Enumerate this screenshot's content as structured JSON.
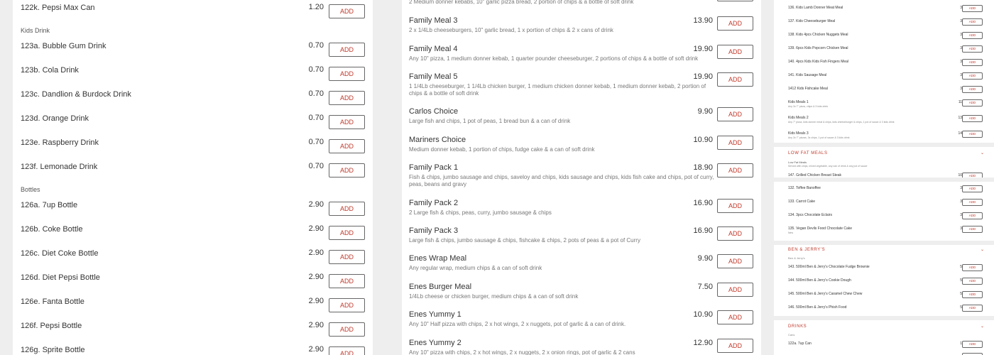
{
  "add_label": "ADD",
  "panel1": {
    "top_item": {
      "name": "122k. Pepsi Max Can",
      "price": "1.20"
    },
    "sections": [
      {
        "title": "Kids Drink",
        "items": [
          {
            "name": "123a. Bubble Gum Drink",
            "price": "0.70"
          },
          {
            "name": "123b. Cola Drink",
            "price": "0.70"
          },
          {
            "name": "123c. Dandlion & Burdock Drink",
            "price": "0.70"
          },
          {
            "name": "123d. Orange Drink",
            "price": "0.70"
          },
          {
            "name": "123e. Raspberry Drink",
            "price": "0.70"
          },
          {
            "name": "123f. Lemonade Drink",
            "price": "0.70"
          }
        ]
      },
      {
        "title": "Bottles",
        "items": [
          {
            "name": "126a. 7up Bottle",
            "price": "2.90"
          },
          {
            "name": "126b. Coke Bottle",
            "price": "2.90"
          },
          {
            "name": "126c. Diet Coke Bottle",
            "price": "2.90"
          },
          {
            "name": "126d. Diet Pepsi Bottle",
            "price": "2.90"
          },
          {
            "name": "126e. Fanta Bottle",
            "price": "2.90"
          },
          {
            "name": "126f. Pepsi Bottle",
            "price": "2.90"
          },
          {
            "name": "126g. Sprite Bottle",
            "price": "2.90"
          }
        ]
      }
    ]
  },
  "panel2": {
    "top_desc": "2 Medium donner kebabs, 10\" garlic pizza bread, 2 portion of chips & a bottle of soft drink",
    "items": [
      {
        "name": "Family Meal 3",
        "price": "13.90",
        "desc": "2 x 1/4Lb cheeseburgers, 10\" garlic bread, 1 x portion of chips & 2 x cans of drink"
      },
      {
        "name": "Family Meal 4",
        "price": "19.90",
        "desc": "Any 10\" pizza, 1 medium donner kebab, 1 quarter pounder cheeseburger, 2 portions of chips & a bottle of soft drink"
      },
      {
        "name": "Family Meal 5",
        "price": "19.90",
        "desc": "1 1/4Lb cheeseburger, 1 1/4Lb chicken burger, 1 medium chicken donner kebab, 1 medium donner kebab, 2 portion of chips & a bottle of soft drink"
      },
      {
        "name": "Carlos Choice",
        "price": "9.90",
        "desc": "Large fish and chips, 1 pot of peas, 1 bread bun & a can of drink"
      },
      {
        "name": "Mariners Choice",
        "price": "10.90",
        "desc": "Medium donner kebab, 1 portion of chips, fudge cake & a can of soft drink"
      },
      {
        "name": "Family Pack 1",
        "price": "18.90",
        "desc": "Fish & chips, jumbo sausage and chips, saveloy and chips, kids sausage and chips, kids fish cake and chips, pot of curry, peas, beans and gravy"
      },
      {
        "name": "Family Pack 2",
        "price": "16.90",
        "desc": "2 Large fish & chips, peas, curry, jumbo sausage & chips"
      },
      {
        "name": "Family Pack 3",
        "price": "16.90",
        "desc": "Large fish & chips, jumbo sausage & chips, fishcake & chips, 2 pots of peas & a pot of Curry"
      },
      {
        "name": "Enes Wrap Meal",
        "price": "9.90",
        "desc": "Any regular wrap, medium chips & a can of soft drink"
      },
      {
        "name": "Enes Burger Meal",
        "price": "7.50",
        "desc": "1/4Lb cheese or chicken burger, medium chips & a can of soft drink"
      },
      {
        "name": "Enes Yummy 1",
        "price": "10.90",
        "desc": "Any 10\" Half pizza with chips, 2 x hot wings, 2 x nuggets, pot of garlic & a can of drink."
      },
      {
        "name": "Enes Yummy 2",
        "price": "12.90",
        "desc": "Any 10\" pizza with chips, 2 x hot wings, 2 x nuggets, 2 x onion rings, pot of garlic & 2 cans"
      }
    ]
  },
  "panel3": {
    "kids_items": [
      {
        "name": "136. Kids Lamb Donner Meat Meal",
        "price": "3.90",
        "sub": ""
      },
      {
        "name": "137. Kids Cheeseburger Meal",
        "price": "3.90",
        "sub": ""
      },
      {
        "name": "138. Kids 4pcs Chicken Nuggets Meal",
        "price": "3.90",
        "sub": ""
      },
      {
        "name": "139. 6pcs Kids Popcorn Chicken Meal",
        "price": "3.90",
        "sub": ""
      },
      {
        "name": "140. 4pcs Kids Kids Fish Fingers Meal",
        "price": "3.90",
        "sub": ""
      },
      {
        "name": "141. Kids Sausage Meal",
        "price": "3.90",
        "sub": ""
      },
      {
        "name": "1412 Kids Fishcake Meal",
        "price": "3.90",
        "sub": ""
      },
      {
        "name": "Kids Meals 1",
        "price": "11.90",
        "sub": "Any 3x 7\" pizza, chips & 3 kids drink"
      },
      {
        "name": "Kids Meals 2",
        "price": "13.90",
        "sub": "Any 7\" pizza, kids donner meat & chips, kids cheeseburger & chips, 1 pot of sauce & 3 kids drink"
      },
      {
        "name": "Kids Meals 3",
        "price": "14.90",
        "sub": "Any 3x 7\" pizzas, 3x chips, 1 pot of sauce & 3 kids drink"
      }
    ],
    "low_fat": {
      "title": "LOW FAT MEALS",
      "chevron": "⌄",
      "sub_title": "Low Fat Meals",
      "sub_desc": "Served with chips, mixed vegetable, any can of drink & any pot of sauce",
      "peek_name": "147. Grilled Chicken Breast Steak",
      "peek_price": "10.90"
    },
    "dessert_items": [
      {
        "name": "132. Toffee Banoffee",
        "price": "3.00",
        "sub": ""
      },
      {
        "name": "133. Carrot Cake",
        "price": "3.00",
        "sub": ""
      },
      {
        "name": "134. 3pcs Chocolate Eclairs",
        "price": "3.00",
        "sub": ""
      },
      {
        "name": "135. Vegan Devils Food Chocolate Cake",
        "price": "3.50",
        "sub": "New"
      }
    ],
    "ben_jerrys": {
      "title": "BEN & JERRY'S",
      "chevron": "⌄",
      "sub": "Ben & Jerry's",
      "items": [
        {
          "name": "143. 500ml Ben & Jerry's Chocolate Fudge Brownie",
          "price": "5.95"
        },
        {
          "name": "144. 500ml Ben & Jerry's Cookie Dough",
          "price": "5.95"
        },
        {
          "name": "145. 500ml Ben & Jerry's Caramel Chew Chew",
          "price": "5.95"
        },
        {
          "name": "146. 500ml Ben & Jerry's Phish Food",
          "price": "5.95"
        }
      ]
    },
    "drinks": {
      "title": "DRINKS",
      "chevron": "⌄",
      "sub": "Cans",
      "items": [
        {
          "name": "122a. 7up Can",
          "price": "1.20"
        }
      ]
    }
  },
  "colors": {
    "accent": "#c0392b",
    "background": "#eeeeee",
    "card": "#ffffff"
  }
}
